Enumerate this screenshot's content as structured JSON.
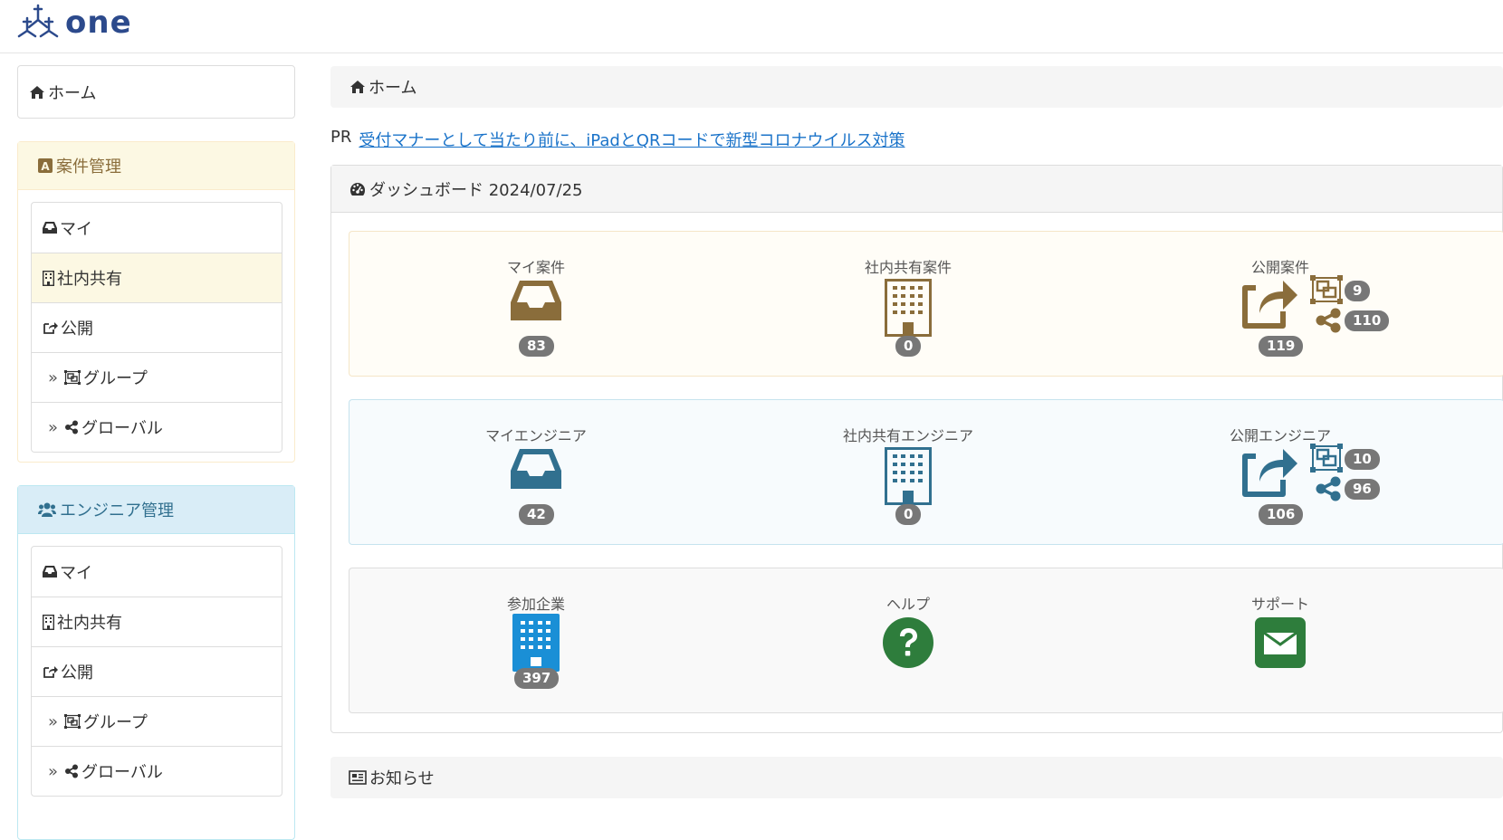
{
  "brand": {
    "name": "one"
  },
  "sidebar": {
    "home": "ホーム",
    "projects": {
      "title": "案件管理",
      "items": [
        {
          "label": "マイ"
        },
        {
          "label": "社内共有"
        },
        {
          "label": "公開"
        },
        {
          "label": "グループ"
        },
        {
          "label": "グローバル"
        }
      ]
    },
    "engineers": {
      "title": "エンジニア管理",
      "items": [
        {
          "label": "マイ"
        },
        {
          "label": "社内共有"
        },
        {
          "label": "公開"
        },
        {
          "label": "グループ"
        },
        {
          "label": "グローバル"
        }
      ]
    }
  },
  "breadcrumb": {
    "home": "ホーム"
  },
  "pr": {
    "prefix": "PR",
    "link": "受付マナーとして当たり前に、iPadとQRコードで新型コロナウイルス対策"
  },
  "dashboard": {
    "title": "ダッシュボード 2024/07/25",
    "projects": {
      "my": {
        "label": "マイ案件",
        "count": "83"
      },
      "shared": {
        "label": "社内共有案件",
        "count": "0"
      },
      "public": {
        "label": "公開案件",
        "count": "119",
        "group": "9",
        "global": "110"
      }
    },
    "engineers": {
      "my": {
        "label": "マイエンジニア",
        "count": "42"
      },
      "shared": {
        "label": "社内共有エンジニア",
        "count": "0"
      },
      "public": {
        "label": "公開エンジニア",
        "count": "106",
        "group": "10",
        "global": "96"
      }
    },
    "misc": {
      "companies": {
        "label": "参加企業",
        "count": "397"
      },
      "help": {
        "label": "ヘルプ"
      },
      "support": {
        "label": "サポート"
      }
    }
  },
  "notice": {
    "title": "お知らせ"
  },
  "colors": {
    "project": "#8a6d3b",
    "engineer": "#31708f",
    "company": "#1a8fd6",
    "green": "#2e7d3c"
  }
}
